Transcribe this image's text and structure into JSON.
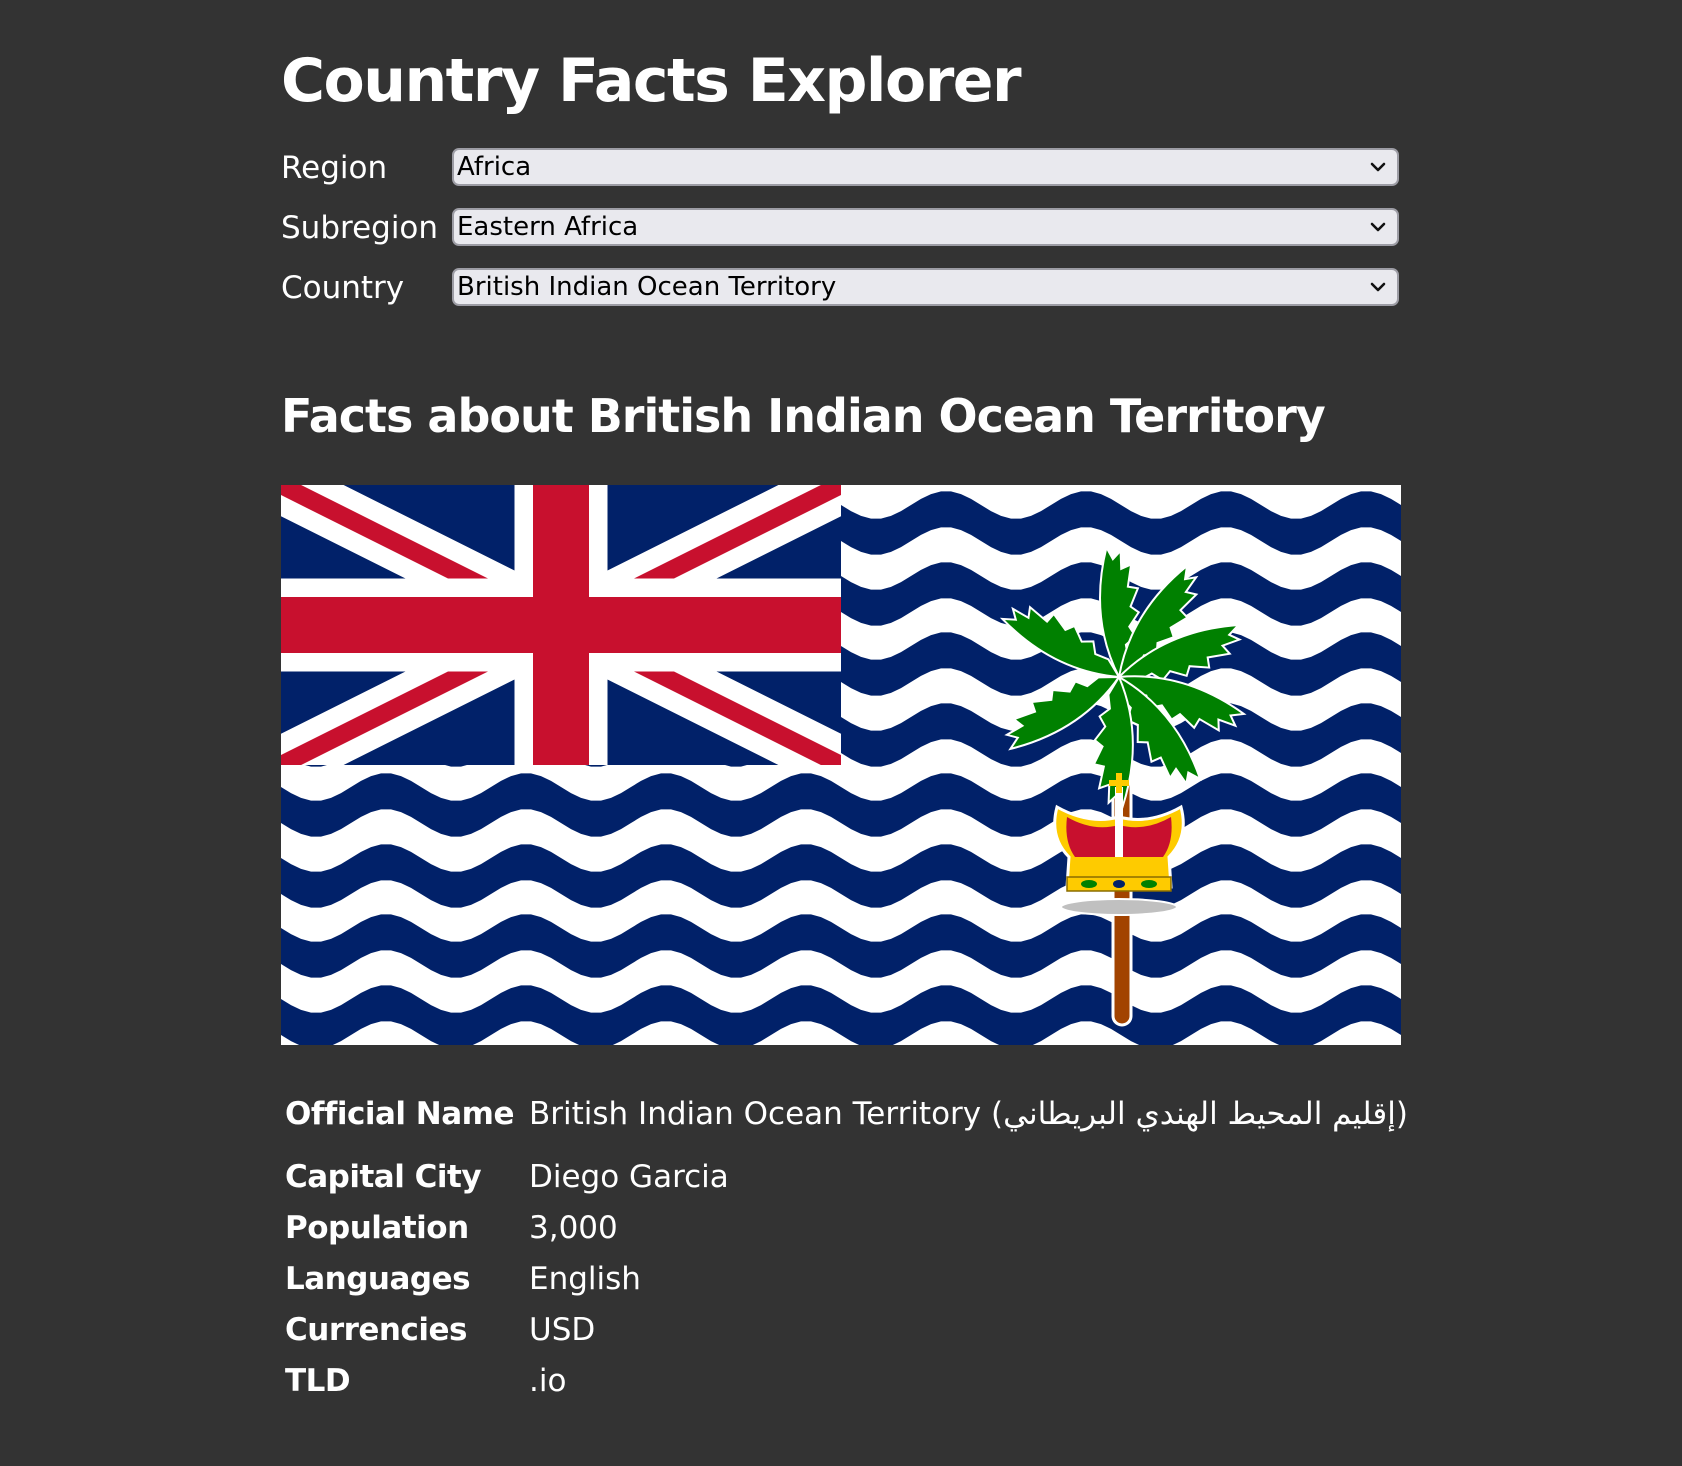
{
  "page": {
    "title": "Country Facts Explorer",
    "background": "#333333"
  },
  "filters": {
    "region": {
      "label": "Region",
      "selected": "Africa"
    },
    "subregion": {
      "label": "Subregion",
      "selected": "Eastern Africa"
    },
    "country": {
      "label": "Country",
      "selected": "British Indian Ocean Territory"
    }
  },
  "facts": {
    "heading": "Facts about British Indian Ocean Territory",
    "flag": {
      "icon": "british-indian-ocean-territory-flag",
      "colors": {
        "navy": "#012169",
        "red": "#C8102E",
        "white": "#FFFFFF",
        "palm": "#008000",
        "trunk": "#A24300",
        "gold": "#FECB00"
      }
    },
    "rows": [
      {
        "label": "Official Name",
        "value": "British Indian Ocean Territory (إقليم المحيط الهندي البريطاني)"
      },
      {
        "label": "Capital City",
        "value": "Diego Garcia"
      },
      {
        "label": "Population",
        "value": "3,000"
      },
      {
        "label": "Languages",
        "value": "English"
      },
      {
        "label": "Currencies",
        "value": "USD"
      },
      {
        "label": "TLD",
        "value": ".io"
      }
    ]
  }
}
